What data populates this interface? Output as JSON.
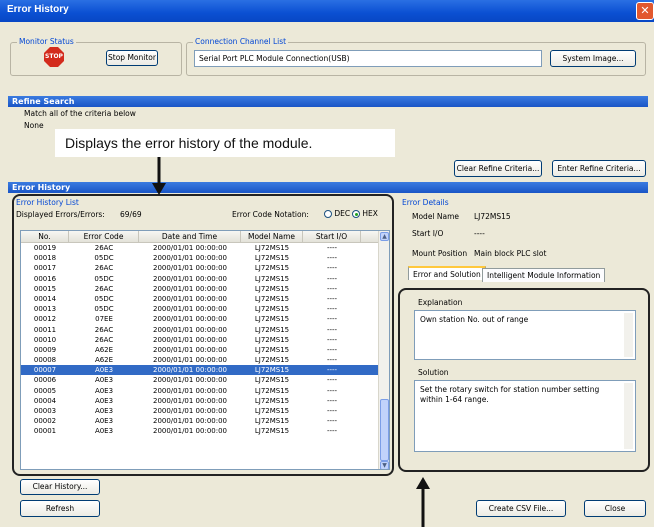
{
  "window": {
    "title": "Error History"
  },
  "monitor_status": {
    "label": "Monitor Status",
    "stop_icon_text": "STOP",
    "stop_button": "Stop Monitor"
  },
  "connection": {
    "label": "Connection Channel List",
    "value": "Serial Port  PLC Module Connection(USB)",
    "system_image_button": "System Image..."
  },
  "refine_search": {
    "header": "Refine Search",
    "match_text": "Match all of the criteria below",
    "criteria_value": "None",
    "clear_button": "Clear Refine Criteria...",
    "enter_button": "Enter Refine Criteria..."
  },
  "callout": {
    "text": "Displays the error history of the module."
  },
  "error_history": {
    "header": "Error History",
    "list_label": "Error History List",
    "displayed_label": "Displayed Errors/Errors:",
    "displayed_value": "69/69",
    "notation_label": "Error Code Notation:",
    "notation_dec": "DEC",
    "notation_hex": "HEX",
    "columns": [
      "No.",
      "Error Code",
      "Date and Time",
      "Model Name",
      "Start I/O"
    ],
    "rows": [
      [
        "00019",
        "26AC",
        "2000/01/01 00:00:00",
        "LJ72MS15",
        "----"
      ],
      [
        "00018",
        "05DC",
        "2000/01/01 00:00:00",
        "LJ72MS15",
        "----"
      ],
      [
        "00017",
        "26AC",
        "2000/01/01 00:00:00",
        "LJ72MS15",
        "----"
      ],
      [
        "00016",
        "05DC",
        "2000/01/01 00:00:00",
        "LJ72MS15",
        "----"
      ],
      [
        "00015",
        "26AC",
        "2000/01/01 00:00:00",
        "LJ72MS15",
        "----"
      ],
      [
        "00014",
        "05DC",
        "2000/01/01 00:00:00",
        "LJ72MS15",
        "----"
      ],
      [
        "00013",
        "05DC",
        "2000/01/01 00:00:00",
        "LJ72MS15",
        "----"
      ],
      [
        "00012",
        "07EE",
        "2000/01/01 00:00:00",
        "LJ72MS15",
        "----"
      ],
      [
        "00011",
        "26AC",
        "2000/01/01 00:00:00",
        "LJ72MS15",
        "----"
      ],
      [
        "00010",
        "26AC",
        "2000/01/01 00:00:00",
        "LJ72MS15",
        "----"
      ],
      [
        "00009",
        "A62E",
        "2000/01/01 00:00:00",
        "LJ72MS15",
        "----"
      ],
      [
        "00008",
        "A62E",
        "2000/01/01 00:00:00",
        "LJ72MS15",
        "----"
      ],
      [
        "00007",
        "A0E3",
        "2000/01/01 00:00:00",
        "LJ72MS15",
        "----"
      ],
      [
        "00006",
        "A0E3",
        "2000/01/01 00:00:00",
        "LJ72MS15",
        "----"
      ],
      [
        "00005",
        "A0E3",
        "2000/01/01 00:00:00",
        "LJ72MS15",
        "----"
      ],
      [
        "00004",
        "A0E3",
        "2000/01/01 00:00:00",
        "LJ72MS15",
        "----"
      ],
      [
        "00003",
        "A0E3",
        "2000/01/01 00:00:00",
        "LJ72MS15",
        "----"
      ],
      [
        "00002",
        "A0E3",
        "2000/01/01 00:00:00",
        "LJ72MS15",
        "----"
      ],
      [
        "00001",
        "A0E3",
        "2000/01/01 00:00:00",
        "LJ72MS15",
        "----"
      ]
    ],
    "selected_row": 12,
    "clear_history_button": "Clear History..."
  },
  "error_details": {
    "label": "Error Details",
    "model_name_label": "Model Name",
    "model_name_value": "LJ72MS15",
    "start_io_label": "Start I/O",
    "start_io_value": "----",
    "mount_position_label": "Mount Position",
    "mount_position_value": "Main block PLC slot",
    "tabs": [
      "Error and Solution",
      "Intelligent Module Information"
    ],
    "explanation_label": "Explanation",
    "explanation_text": "Own station No. out of range",
    "solution_label": "Solution",
    "solution_text": "Set the rotary switch for station number setting within 1-64 range."
  },
  "footer": {
    "refresh_button": "Refresh",
    "create_csv_button": "Create CSV File...",
    "close_button": "Close"
  },
  "colors": {
    "title_bar": "#0a4fd2",
    "section_bar": "#1955c6",
    "selection": "#316ac5"
  }
}
